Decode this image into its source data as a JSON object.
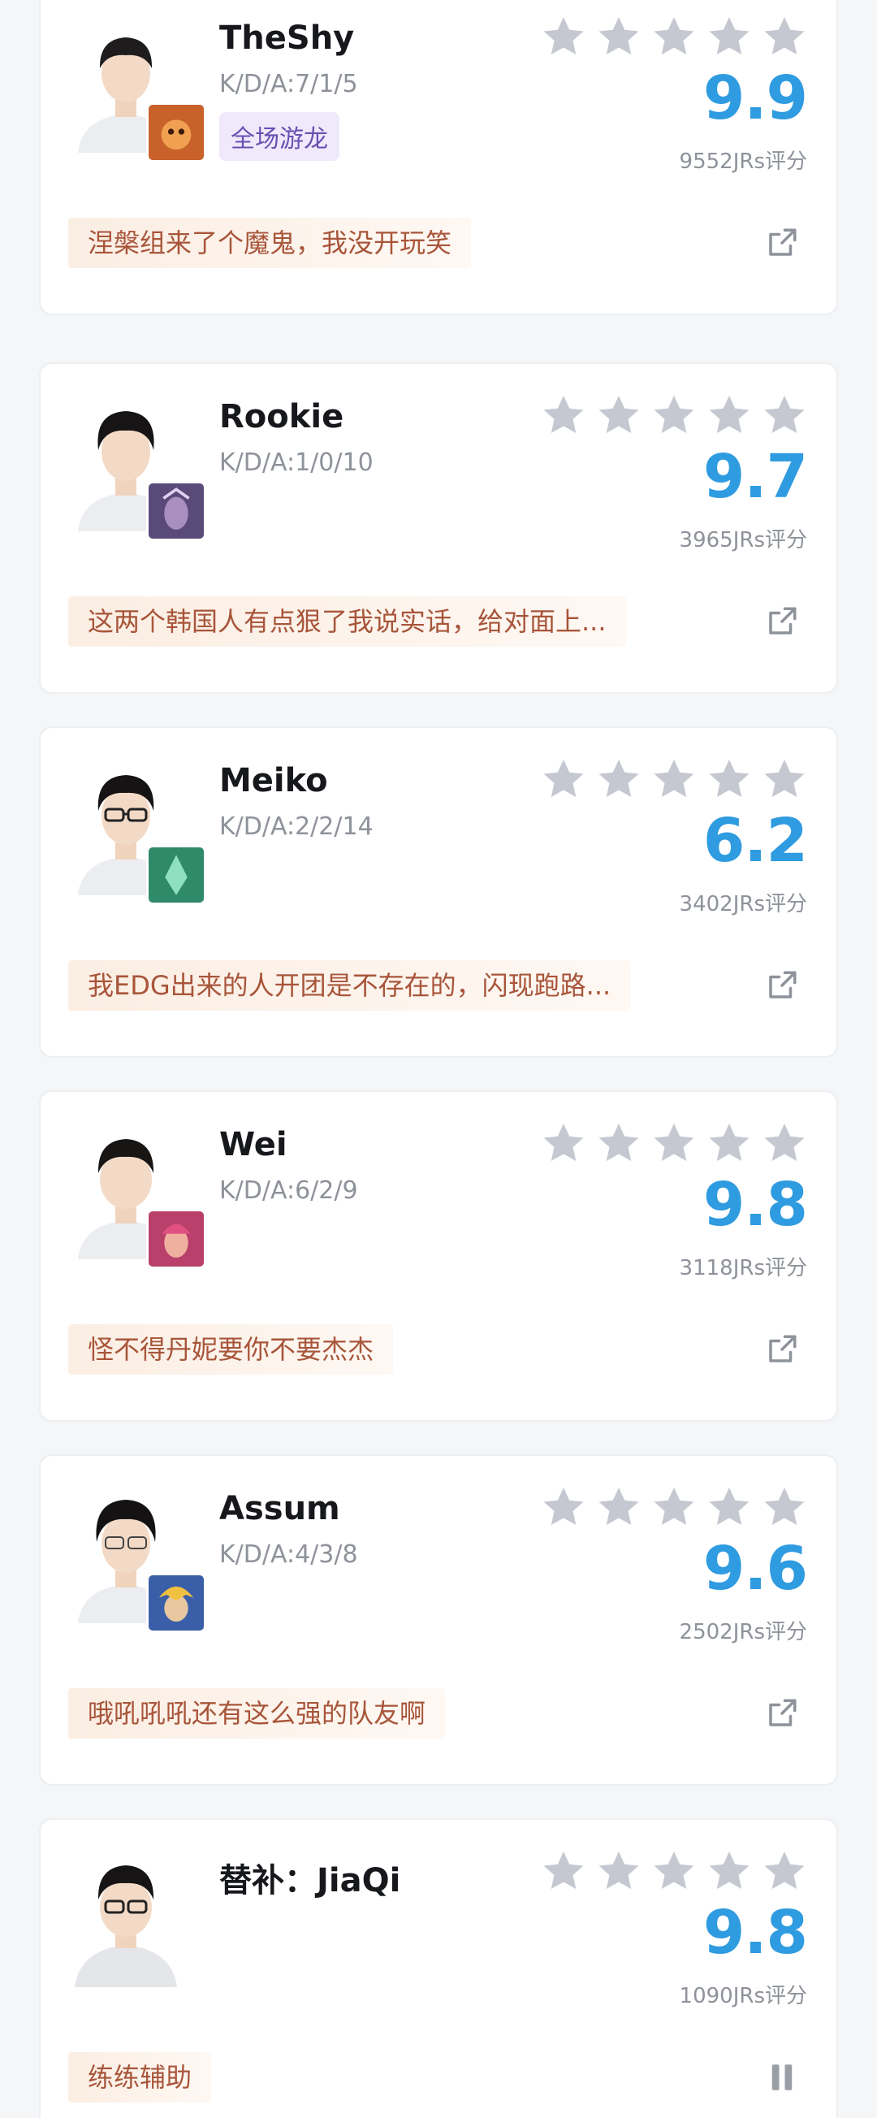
{
  "players": [
    {
      "name": "TheShy",
      "kda": "K/D/A:7/1/5",
      "tag": "全场游龙",
      "rating": "9.9",
      "rating_count": "9552JRs评分",
      "comment": "涅槃组来了个魔鬼，我没开玩笑",
      "hero_icon_color": "#c8612a"
    },
    {
      "name": "Rookie",
      "kda": "K/D/A:1/0/10",
      "tag": "",
      "rating": "9.7",
      "rating_count": "3965JRs评分",
      "comment": "这两个韩国人有点狠了我说实话，给对面上...",
      "hero_icon_color": "#5a4a7a"
    },
    {
      "name": "Meiko",
      "kda": "K/D/A:2/2/14",
      "tag": "",
      "rating": "6.2",
      "rating_count": "3402JRs评分",
      "comment": "我EDG出来的人开团是不存在的，闪现跑路...",
      "hero_icon_color": "#2f8a6a"
    },
    {
      "name": "Wei",
      "kda": "K/D/A:6/2/9",
      "tag": "",
      "rating": "9.8",
      "rating_count": "3118JRs评分",
      "comment": "怪不得丹妮要你不要杰杰",
      "hero_icon_color": "#b8406a"
    },
    {
      "name": "Assum",
      "kda": "K/D/A:4/3/8",
      "tag": "",
      "rating": "9.6",
      "rating_count": "2502JRs评分",
      "comment": "哦吼吼吼还有这么强的队友啊",
      "hero_icon_color": "#3a5fa8"
    },
    {
      "name": "替补：JiaQi",
      "kda": "",
      "tag": "",
      "rating": "9.8",
      "rating_count": "1090JRs评分",
      "comment": "练练辅助",
      "hero_icon_color": ""
    }
  ],
  "colors": {
    "rating": "#2f9be0",
    "star_empty": "#c5c8d0",
    "comment_text": "#a8553a",
    "tag_bg": "#efe9fb"
  },
  "icons": {
    "star": "star-icon",
    "share": "share-icon",
    "pause": "pause-icon"
  }
}
